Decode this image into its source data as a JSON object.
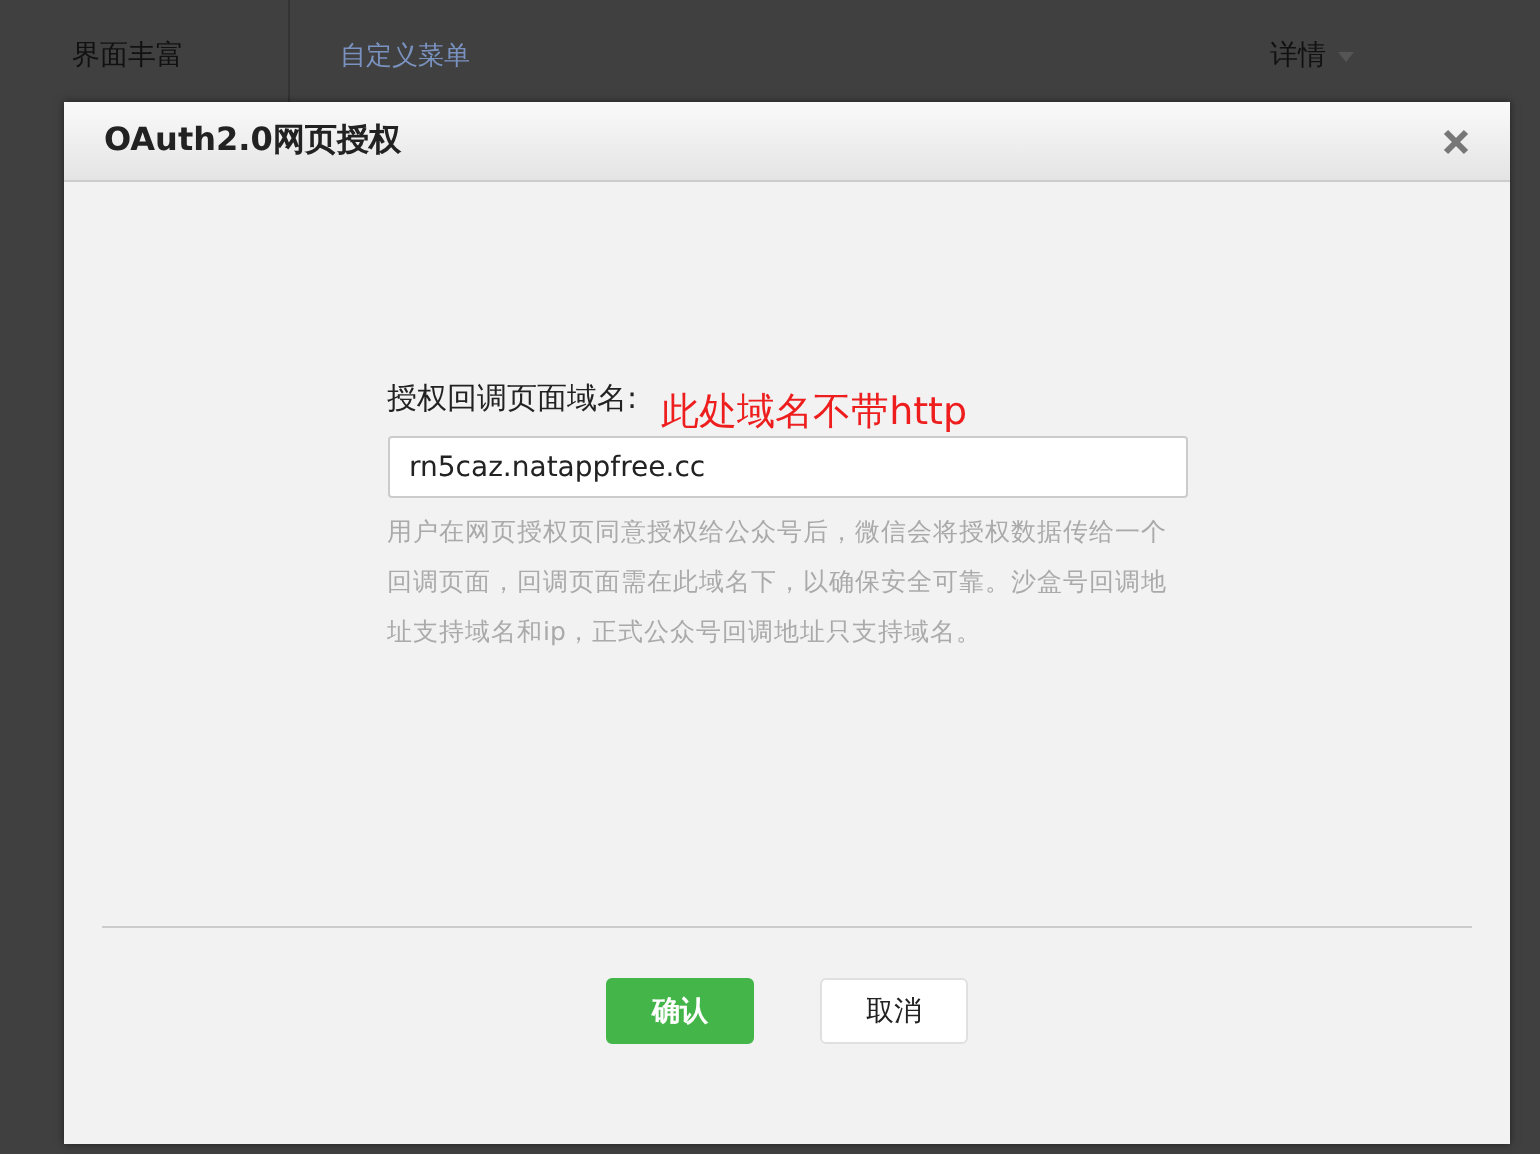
{
  "background_page": {
    "section": "界面丰富",
    "link": "自定义菜单",
    "details": "详情"
  },
  "dialog": {
    "title": "OAuth2.0网页授权",
    "field_label": "授权回调页面域名:",
    "annotation": "此处域名不带http",
    "field_value": "rn5caz.natappfree.cc",
    "hint": "用户在网页授权页同意授权给公众号后，微信会将授权数据传给一个回调页面，回调页面需在此域名下，以确保安全可靠。沙盒号回调地址支持域名和ip，正式公众号回调地址只支持域名。",
    "buttons": [
      {
        "label": "确认",
        "kind": "primary"
      },
      {
        "label": "取消",
        "kind": "default"
      }
    ]
  }
}
